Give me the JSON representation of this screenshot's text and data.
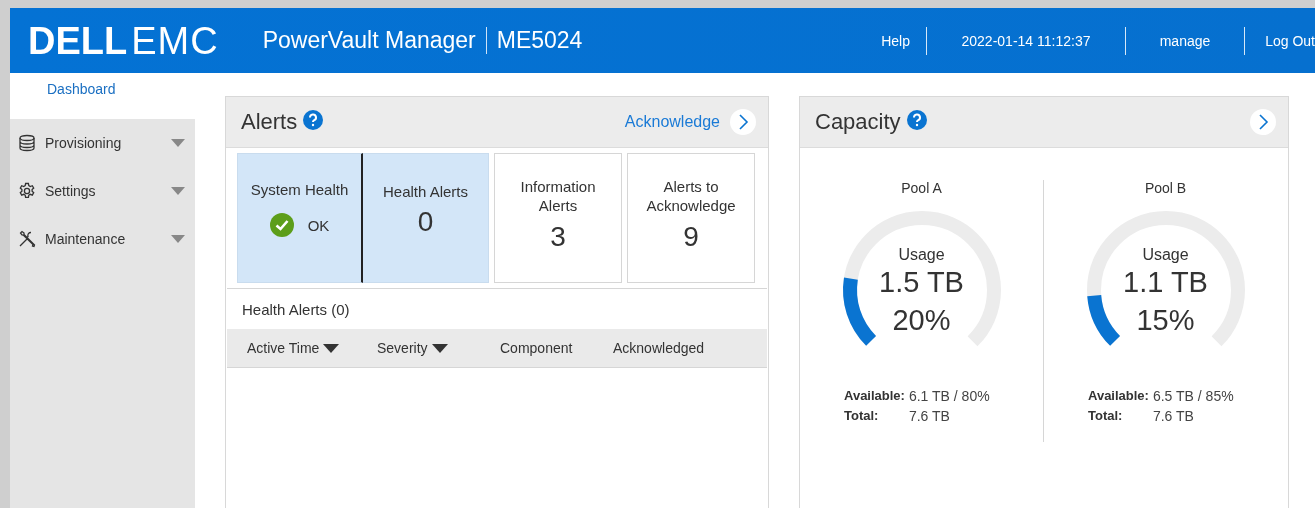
{
  "header": {
    "logo": {
      "brand": "DELL",
      "suffix": "EMC"
    },
    "title": "PowerVault Manager",
    "model": "ME5024",
    "links": [
      "Help",
      "2022-01-14 11:12:37",
      "manage",
      "Log Out"
    ]
  },
  "sidebar": {
    "items": [
      {
        "label": "Dashboard",
        "kind": "plain",
        "selected": true
      },
      {
        "label": "Provisioning",
        "kind": "database",
        "selected": false,
        "expanded": false
      },
      {
        "label": "Settings",
        "kind": "gear",
        "selected": false,
        "expanded": false
      },
      {
        "label": "Maintenance",
        "kind": "tools",
        "selected": false,
        "expanded": false
      }
    ]
  },
  "alerts": {
    "title": "Alerts",
    "action": "Acknowledge",
    "tiles": [
      {
        "kind": "status",
        "label": "System Health",
        "status": "OK",
        "selected": true
      },
      {
        "kind": "count",
        "label": "Health Alerts",
        "value": "0",
        "selected": true
      },
      {
        "kind": "count",
        "label": "Information Alerts",
        "value": "3",
        "selected": false
      },
      {
        "kind": "count",
        "label": "Alerts to Acknowledge",
        "value": "9",
        "selected": false
      }
    ],
    "table": {
      "title": "Health Alerts (0)",
      "columns": [
        {
          "label": "Active Time",
          "sortable": true
        },
        {
          "label": "Severity",
          "sortable": true
        },
        {
          "label": "Component",
          "sortable": false
        },
        {
          "label": "Acknowledged",
          "sortable": false
        }
      ]
    }
  },
  "capacity": {
    "title": "Capacity",
    "pools": [
      {
        "name": "Pool A",
        "caption": "Usage",
        "used": "1.5 TB",
        "percent": "20%",
        "level": 0.2,
        "available_label": "Available:",
        "available": "6.1 TB / 80%",
        "total_label": "Total:",
        "total": "7.6 TB"
      },
      {
        "name": "Pool B",
        "caption": "Usage",
        "used": "1.1 TB",
        "percent": "15%",
        "level": 0.15,
        "available_label": "Available:",
        "available": "6.5 TB / 85%",
        "total_label": "Total:",
        "total": "7.6 TB"
      }
    ]
  }
}
